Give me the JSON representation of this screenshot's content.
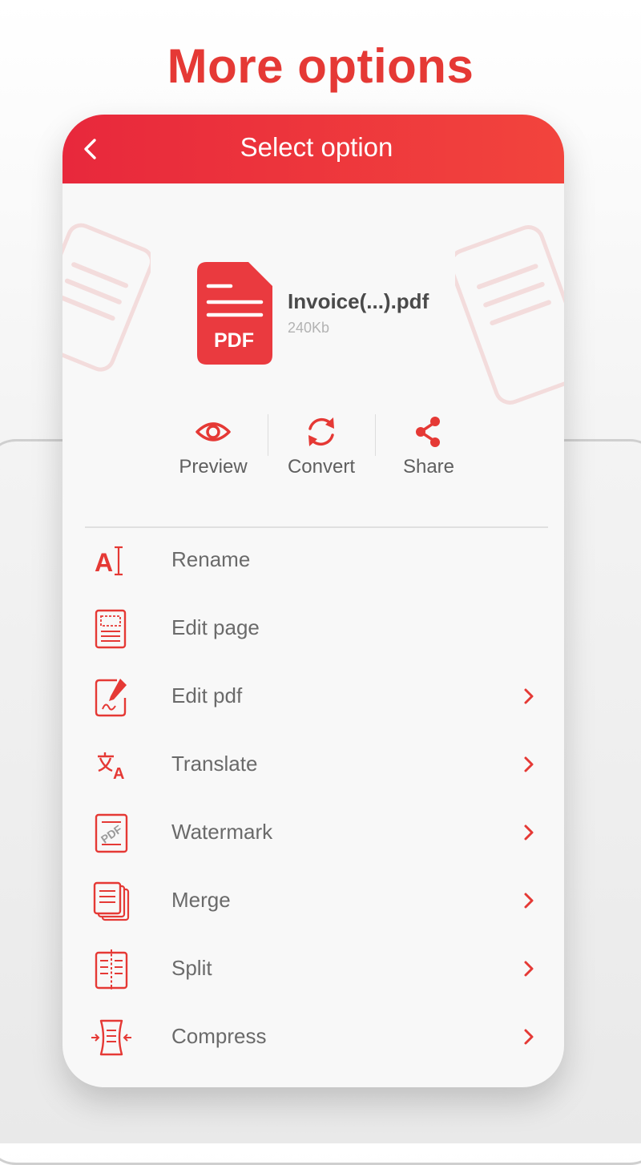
{
  "headline": "More options",
  "appbar": {
    "title": "Select option",
    "back_icon": "chevron-left-icon"
  },
  "file": {
    "icon_text": "PDF",
    "name": "Invoice(...).pdf",
    "size": "240Kb"
  },
  "actions": [
    {
      "label": "Preview",
      "icon": "eye-icon"
    },
    {
      "label": "Convert",
      "icon": "refresh-icon"
    },
    {
      "label": "Share",
      "icon": "share-icon"
    }
  ],
  "menu": [
    {
      "label": "Rename",
      "icon": "rename-icon",
      "has_chevron": false
    },
    {
      "label": "Edit page",
      "icon": "edit-page-icon",
      "has_chevron": false
    },
    {
      "label": "Edit pdf",
      "icon": "edit-pdf-icon",
      "has_chevron": true
    },
    {
      "label": "Translate",
      "icon": "translate-icon",
      "has_chevron": true
    },
    {
      "label": "Watermark",
      "icon": "watermark-icon",
      "has_chevron": true
    },
    {
      "label": "Merge",
      "icon": "merge-icon",
      "has_chevron": true
    },
    {
      "label": "Split",
      "icon": "split-icon",
      "has_chevron": true
    },
    {
      "label": "Compress",
      "icon": "compress-icon",
      "has_chevron": true
    }
  ],
  "colors": {
    "accent": "#e53935",
    "header_start": "#e8283c",
    "header_end": "#f2443d",
    "text": "#6a6a6a"
  }
}
